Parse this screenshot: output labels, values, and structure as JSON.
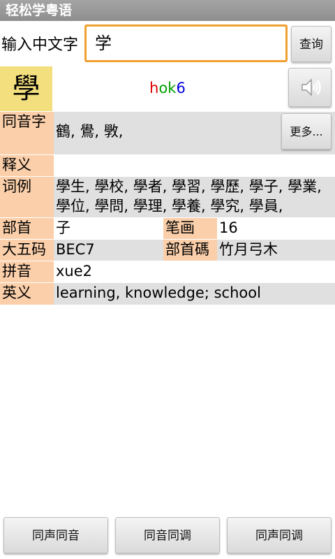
{
  "app": {
    "title": "轻松学粤语"
  },
  "search": {
    "label": "输入中文字",
    "value": "学",
    "query_button": "查询"
  },
  "result": {
    "character": "學",
    "jyutping": {
      "initial": "h",
      "final": "ok",
      "tone": "6"
    },
    "jyutping_colors": {
      "initial": "#e00000",
      "final": "#00a000",
      "tone": "#0000e0"
    }
  },
  "homophones": {
    "label": "同音字",
    "value": "鶴, 鷽, 斆,",
    "more_button": "更多..."
  },
  "meaning": {
    "label": "释义",
    "value": ""
  },
  "examples": {
    "label": "词例",
    "value": "學生, 學校, 學者, 學習, 學歷, 學子, 學業, 學位, 學問, 學理, 學養, 學究, 學員,"
  },
  "radical": {
    "label": "部首",
    "value": "子"
  },
  "strokes": {
    "label": "笔画",
    "value": "16"
  },
  "big5": {
    "label": "大五码",
    "value": "BEC7"
  },
  "radical_code": {
    "label": "部首碼",
    "value": "竹月弓木"
  },
  "pinyin": {
    "label": "拼音",
    "value": "xue2"
  },
  "english": {
    "label": "英义",
    "value": "learning, knowledge; school"
  },
  "bottom_buttons": [
    "同声同音",
    "同音同调",
    "同声同调"
  ],
  "colors": {
    "label_bg": "#fbcfaa",
    "value_bg": "#e0e0e0",
    "char_bg": "#f3df7e",
    "input_border": "#f0a030"
  }
}
